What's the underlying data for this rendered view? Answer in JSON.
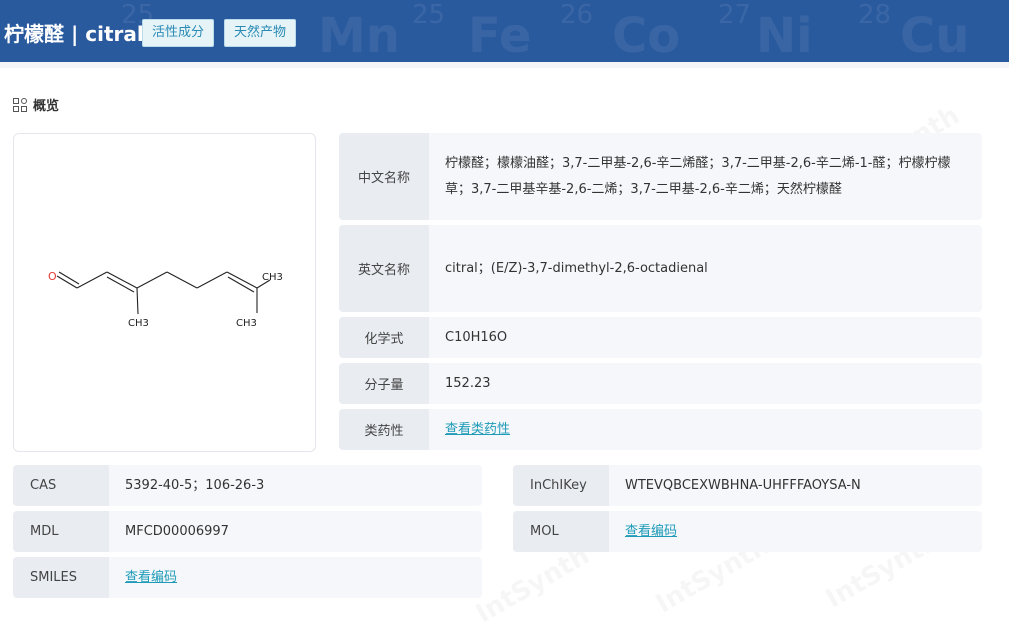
{
  "header": {
    "title": "柠檬醛 | citral",
    "tags": [
      "活性成分",
      "天然产物"
    ],
    "bg_elements": [
      "Mn",
      "Fe",
      "Co",
      "Ni",
      "Cu"
    ],
    "bg_numbers": [
      "25",
      "26",
      "27",
      "28"
    ]
  },
  "overview_label": "概览",
  "structure": {
    "atoms": {
      "o": "O",
      "ch3_right": "CH3",
      "ch3_left": "CH3",
      "ch3_bottom": "CH3"
    }
  },
  "props": [
    {
      "label": "中文名称",
      "value": "柠檬醛；檬檬油醛；3,7-二甲基-2,6-辛二烯醛；3,7-二甲基-2,6-辛二烯-1-醛；柠檬柠檬草；3,7-二甲基辛基-2,6-二烯；3,7-二甲基-2,6-辛二烯；天然柠檬醛"
    },
    {
      "label": "英文名称",
      "value": "citral；(E/Z)-3,7-dimethyl-2,6-octadienal"
    },
    {
      "label": "化学式",
      "value": "C10H16O"
    },
    {
      "label": "分子量",
      "value": "152.23"
    },
    {
      "label": "类药性",
      "value": "查看类药性"
    }
  ],
  "ids": {
    "cas": {
      "label": "CAS",
      "value": "5392-40-5；106-26-3"
    },
    "inchikey": {
      "label": "InChIKey",
      "value": "WTEVQBCEXWBHNA-UHFFFAOYSA-N"
    },
    "mdl": {
      "label": "MDL",
      "value": "MFCD00006997"
    },
    "mol": {
      "label": "MOL",
      "value": "查看编码"
    },
    "smiles": {
      "label": "SMILES",
      "value": "查看编码"
    }
  },
  "watermark": "IntSynth",
  "colors": {
    "header": "#2a5a9e",
    "link": "#1f9bb8",
    "label_bg": "#e9edf2",
    "row_bg": "#f5f7fa"
  }
}
